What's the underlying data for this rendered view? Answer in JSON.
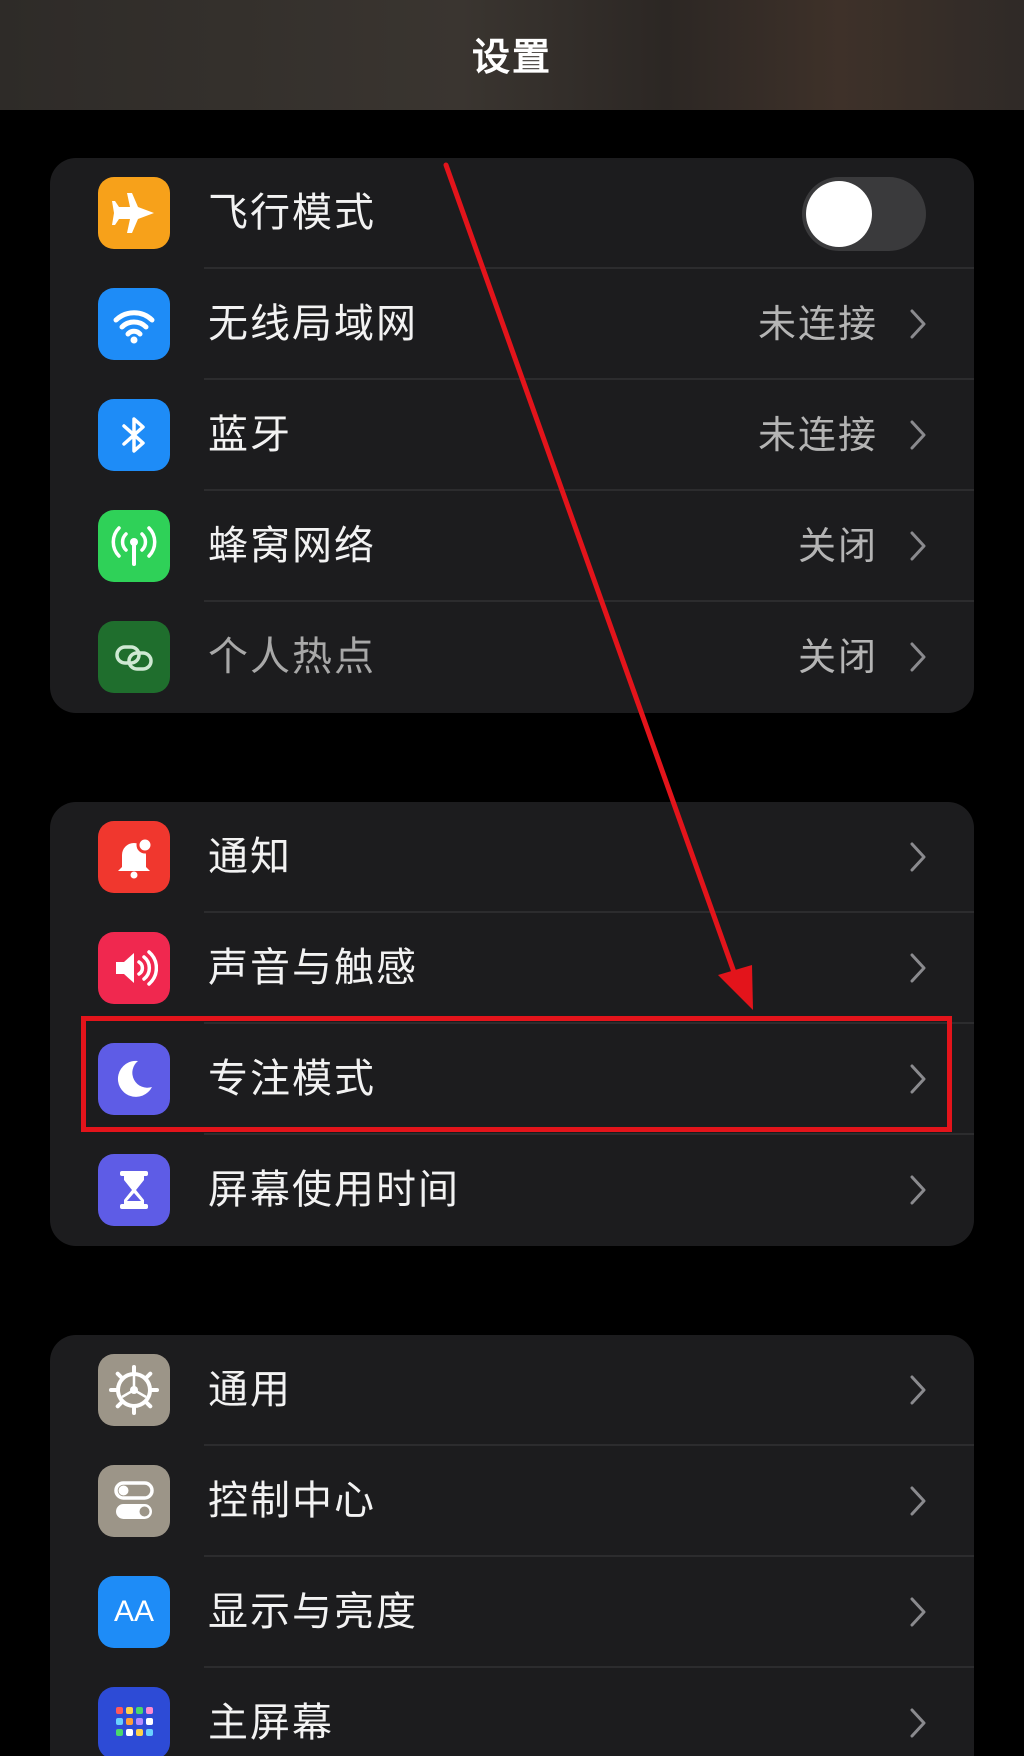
{
  "header": {
    "title": "设置"
  },
  "groups": [
    {
      "items": [
        {
          "id": "airplane",
          "label": "飞行模式",
          "icon": "airplane-icon",
          "icon_color": "#f7a11a",
          "control": "toggle",
          "toggle_on": false
        },
        {
          "id": "wifi",
          "label": "无线局域网",
          "value": "未连接",
          "icon": "wifi-icon",
          "icon_color": "#1e8cf7"
        },
        {
          "id": "bluetooth",
          "label": "蓝牙",
          "value": "未连接",
          "icon": "bluetooth-icon",
          "icon_color": "#1e8cf7"
        },
        {
          "id": "cellular",
          "label": "蜂窝网络",
          "value": "关闭",
          "icon": "cellular-antenna-icon",
          "icon_color": "#2fd158"
        },
        {
          "id": "hotspot",
          "label": "个人热点",
          "value": "关闭",
          "icon": "hotspot-chain-icon",
          "icon_color": "#1f6e2d",
          "dimmed": true
        }
      ]
    },
    {
      "items": [
        {
          "id": "notifications",
          "label": "通知",
          "icon": "bell-icon",
          "icon_color": "#f0372e"
        },
        {
          "id": "sounds",
          "label": "声音与触感",
          "icon": "speaker-icon",
          "icon_color": "#f0284f"
        },
        {
          "id": "focus",
          "label": "专注模式",
          "icon": "moon-icon",
          "icon_color": "#5e5ce6",
          "highlighted": true
        },
        {
          "id": "screen_time",
          "label": "屏幕使用时间",
          "icon": "hourglass-icon",
          "icon_color": "#5e5ce6"
        }
      ]
    },
    {
      "items": [
        {
          "id": "general",
          "label": "通用",
          "icon": "gear-icon",
          "icon_color": "#9c9588"
        },
        {
          "id": "control_center",
          "label": "控制中心",
          "icon": "switches-icon",
          "icon_color": "#9c9588"
        },
        {
          "id": "display",
          "label": "显示与亮度",
          "icon": "aa-text-icon",
          "icon_color": "#1e8cf7",
          "icon_text": "AA"
        },
        {
          "id": "home_screen",
          "label": "主屏幕",
          "icon": "app-grid-icon",
          "icon_color": "#2d4bd6"
        }
      ]
    }
  ],
  "annotation": {
    "arrow_color": "#e3141b",
    "box_color": "#e3141b",
    "target": "focus"
  }
}
